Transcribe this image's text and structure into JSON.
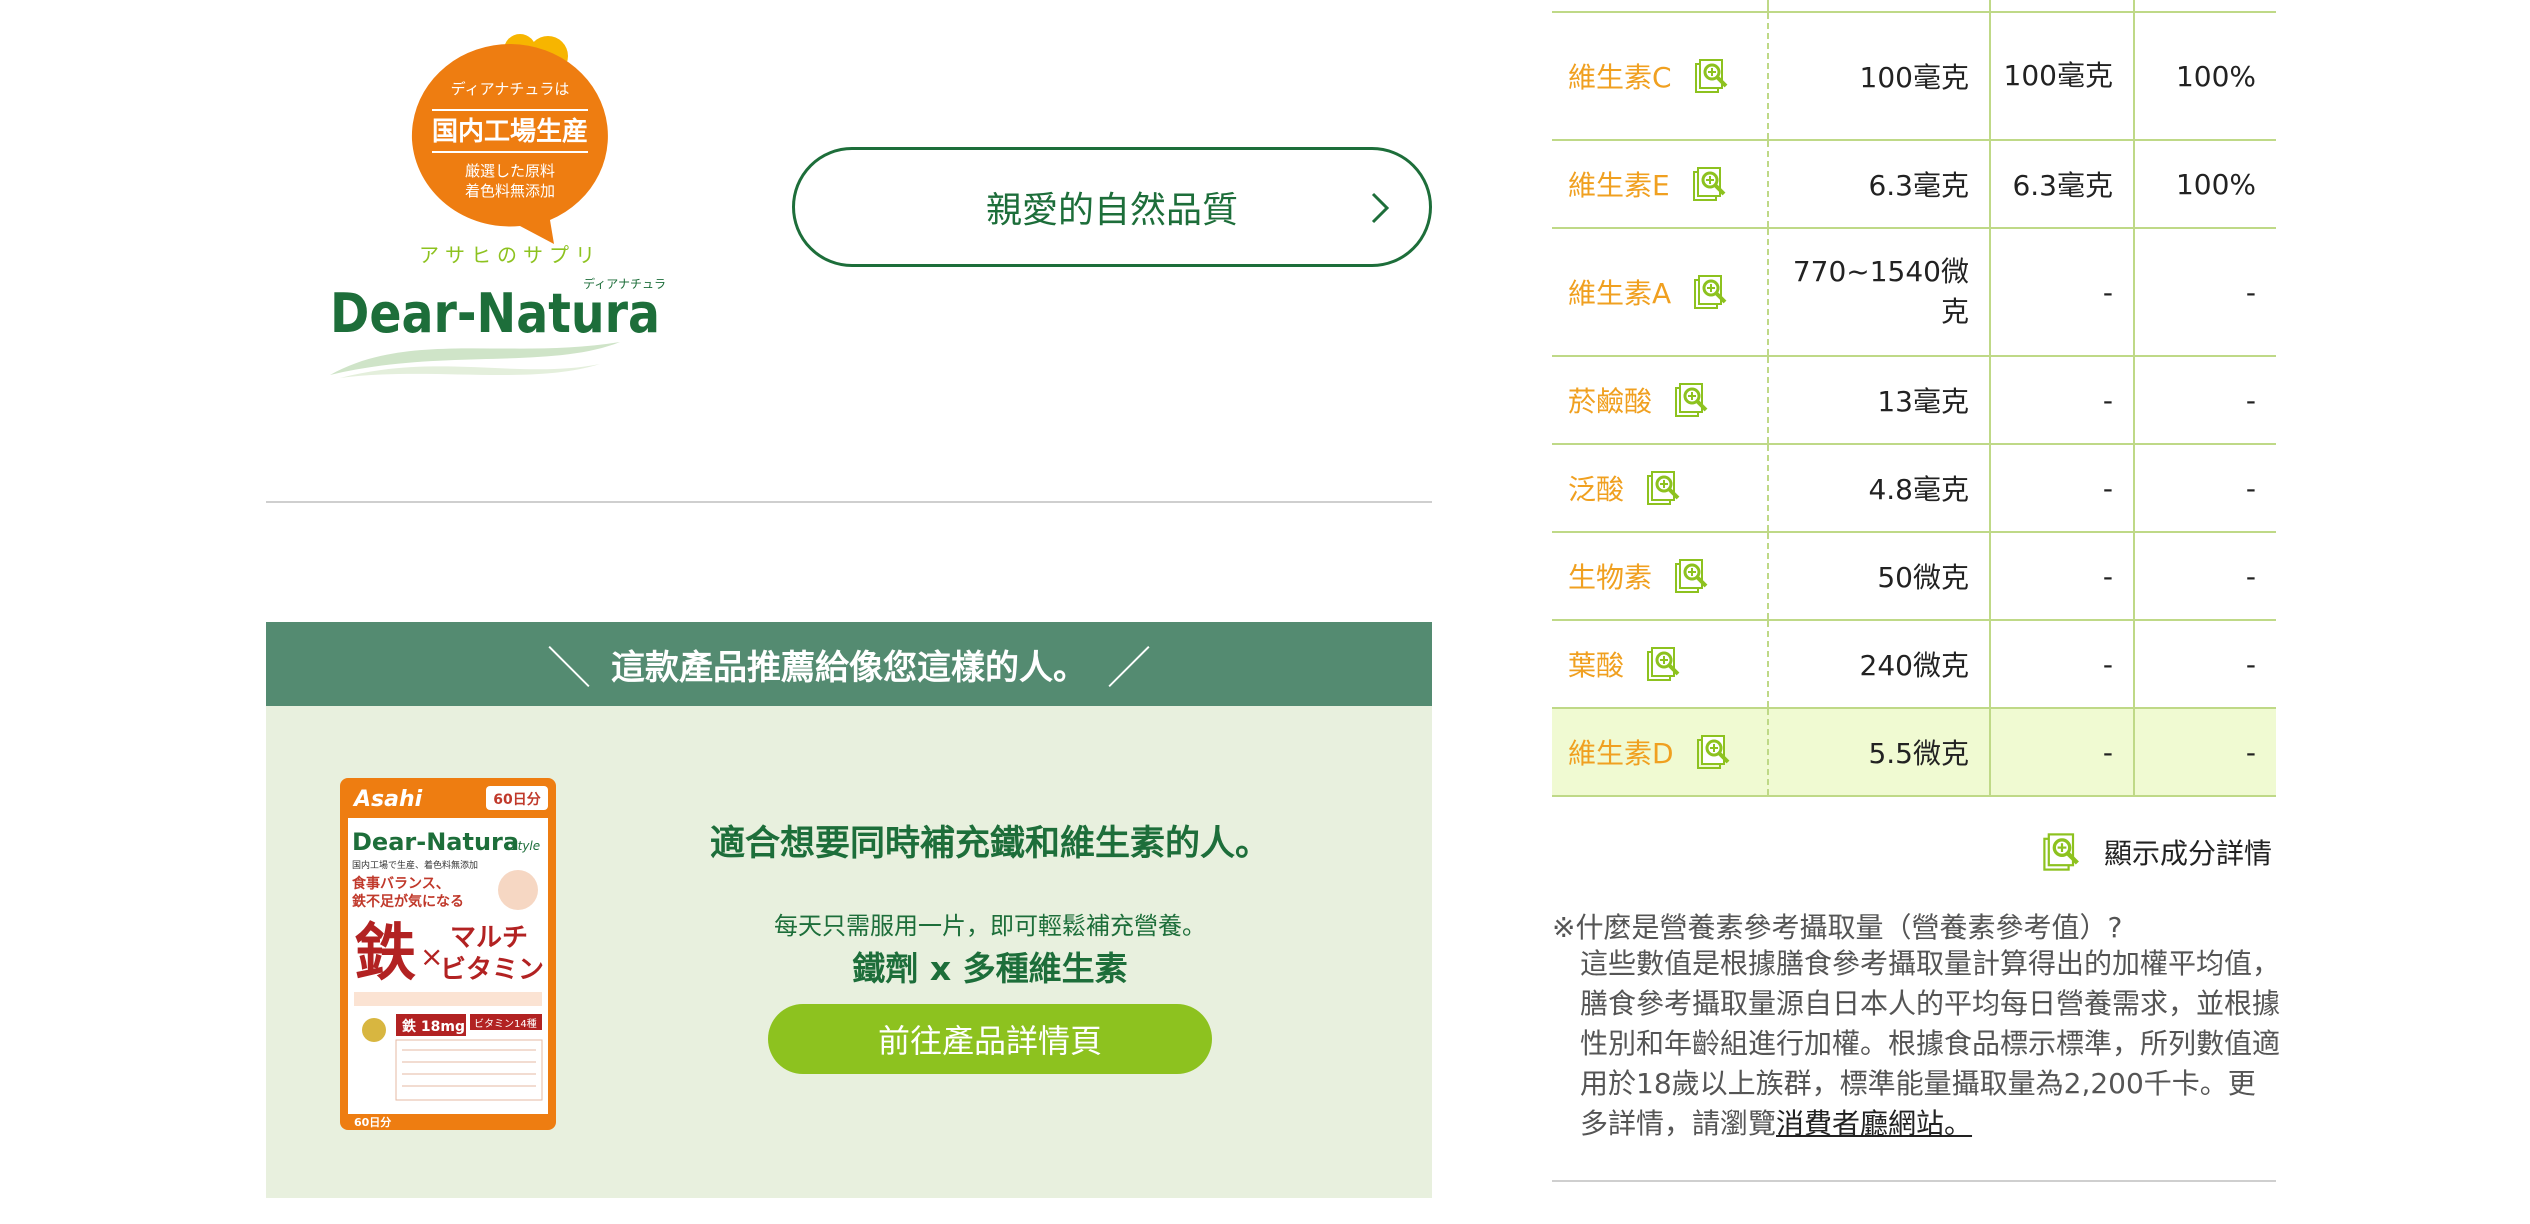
{
  "brand": {
    "bubble_small": "ディアナチュラは",
    "bubble_main": "国内工場生産",
    "bubble_line1": "厳選した原料",
    "bubble_line2": "着色料無添加",
    "tagline": "アサヒのサプリ",
    "name": "Dear-Natura",
    "name_kana": "ディアナチュラ",
    "quality_button": "親愛的自然品質"
  },
  "recommend": {
    "header": "這款產品推薦給像您這樣的人。",
    "title": "適合想要同時補充鐵和維生素的人。",
    "desc": "每天只需服用一片，即可輕鬆補充營養。",
    "sub": "鐵劑 x 多種維生素",
    "button": "前往產品詳情頁"
  },
  "product_pack": {
    "maker": "Asahi",
    "days_badge": "60日分",
    "brand": "Dear-Natura",
    "style": "Style",
    "line1": "国内工場で生産、着色料無添加",
    "line2": "食事バランス、",
    "line3": "鉄不足が気になる",
    "iron": "鉄",
    "x": "×",
    "multi1": "マルチ",
    "multi2": "ビタミン",
    "iron_amount": "鉄 18mg",
    "vitamin_count": "ビタミン14種",
    "bottom": "60日分"
  },
  "nutrients": [
    {
      "name": "維生素C",
      "amount": "100毫克",
      "value": "100毫克",
      "percent": "100%"
    },
    {
      "name": "維生素E",
      "amount": "6.3毫克",
      "value": "6.3毫克",
      "percent": "100%"
    },
    {
      "name": "維生素A",
      "amount": "770~1540微克",
      "value": "-",
      "percent": "-"
    },
    {
      "name": "菸鹼酸",
      "amount": "13毫克",
      "value": "-",
      "percent": "-"
    },
    {
      "name": "泛酸",
      "amount": "4.8毫克",
      "value": "-",
      "percent": "-"
    },
    {
      "name": "生物素",
      "amount": "50微克",
      "value": "-",
      "percent": "-"
    },
    {
      "name": "葉酸",
      "amount": "240微克",
      "value": "-",
      "percent": "-"
    },
    {
      "name": "維生素D",
      "amount": "5.5微克",
      "value": "-",
      "percent": "-"
    }
  ],
  "detail_link": "顯示成分詳情",
  "note": {
    "question": "※什麼是營養素參考攝取量（營養素參考值）?",
    "body": "這些數值是根據膳食參考攝取量計算得出的加權平均值，膳食參考攝取量源自日本人的平均每日營養需求，並根據性別和年齡組進行加權。根據食品標示標準，所列數值適用於18歲以上族群，標準能量攝取量為2,200千卡。更多詳情，請瀏覽",
    "link": "消費者廳網站。"
  },
  "colors": {
    "brand_green": "#1d6e3a",
    "header_green": "#548b71",
    "panel_bg": "#e8f0de",
    "button_lime": "#8dc21f",
    "nutrient_orange": "#f0a020",
    "logo_orange": "#ee7d11"
  }
}
